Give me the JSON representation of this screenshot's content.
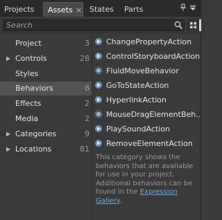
{
  "tabs": [
    {
      "label": "Projects",
      "active": false
    },
    {
      "label": "Assets",
      "active": true,
      "closable": true
    },
    {
      "label": "States",
      "active": false
    },
    {
      "label": "Parts",
      "active": false
    }
  ],
  "tab_close_glyph": "×",
  "window_icons": [
    "pin-icon",
    "menu-icon"
  ],
  "search": {
    "placeholder": "Search",
    "value": ""
  },
  "view_toggle_icons": [
    "grid-view-icon",
    "list-view-icon"
  ],
  "categories": [
    {
      "label": "Project",
      "count": "3",
      "expandable": false,
      "selected": false
    },
    {
      "label": "Controls",
      "count": "28",
      "expandable": true,
      "selected": false
    },
    {
      "label": "Styles",
      "count": "",
      "expandable": false,
      "selected": false
    },
    {
      "label": "Behaviors",
      "count": "8",
      "expandable": false,
      "selected": true
    },
    {
      "label": "Effects",
      "count": "2",
      "expandable": false,
      "selected": false
    },
    {
      "label": "Media",
      "count": "2",
      "expandable": false,
      "selected": false
    },
    {
      "label": "Categories",
      "count": "9",
      "expandable": true,
      "selected": false
    },
    {
      "label": "Locations",
      "count": "81",
      "expandable": true,
      "selected": false
    }
  ],
  "behaviors": [
    {
      "label": "ChangePropertyAction",
      "icon": "action-icon"
    },
    {
      "label": "ControlStoryboardAction",
      "icon": "action-icon"
    },
    {
      "label": "FluidMoveBehavior",
      "icon": "behavior-icon"
    },
    {
      "label": "GoToStateAction",
      "icon": "action-icon"
    },
    {
      "label": "HyperlinkAction",
      "icon": "action-icon"
    },
    {
      "label": "MouseDragElementBeh...",
      "icon": "behavior-icon"
    },
    {
      "label": "PlaySoundAction",
      "icon": "action-icon"
    },
    {
      "label": "RemoveElementAction",
      "icon": "action-icon"
    }
  ],
  "description": {
    "text": "This category shows the behaviors that are available for use in your project. Additional behaviors can be found in the ",
    "link_part1": "Expression",
    "link_part2": "Gallery",
    "end": "."
  },
  "colors": {
    "panel_bg": "#3a3a3a",
    "tabbar_bg": "#2a2a2a",
    "selected_bg": "#525252",
    "link": "#73a7dd",
    "muted_text": "#9a9a9a"
  }
}
